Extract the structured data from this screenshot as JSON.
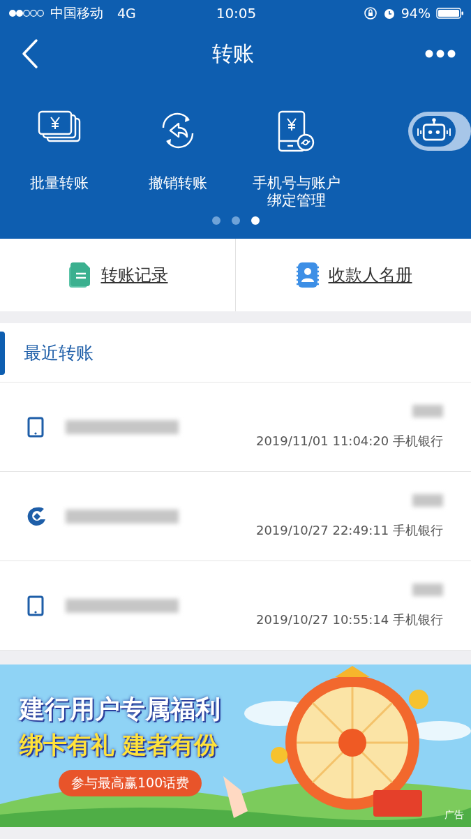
{
  "status_bar": {
    "carrier": "中国移动",
    "network": "4G",
    "time": "10:05",
    "battery": "94%"
  },
  "nav": {
    "title": "转账"
  },
  "shortcuts": [
    {
      "label": "批量转账",
      "kind": "batch"
    },
    {
      "label": "撤销转账",
      "kind": "revoke"
    },
    {
      "label": "手机号与账户绑定管理",
      "kind": "phone-bind"
    }
  ],
  "pager": [
    {
      "selected": false
    },
    {
      "selected": false
    },
    {
      "selected": true
    }
  ],
  "quick_links": [
    {
      "label": "转账记录",
      "kind": "record"
    },
    {
      "label": "收款人名册",
      "kind": "payees"
    }
  ],
  "recent": {
    "title": "最近转账",
    "rows": [
      {
        "kind": "phone",
        "detail": "2019/11/01 11:04:20 手机银行"
      },
      {
        "kind": "bank",
        "detail": "2019/10/27 22:49:11 手机银行"
      },
      {
        "kind": "phone",
        "detail": "2019/10/27 10:55:14 手机银行"
      }
    ]
  },
  "banner": {
    "headline": "建行用户专属福利",
    "subline": "绑卡有礼 建者有份",
    "cta": "参与最高赢100话费",
    "tag": "广告"
  }
}
